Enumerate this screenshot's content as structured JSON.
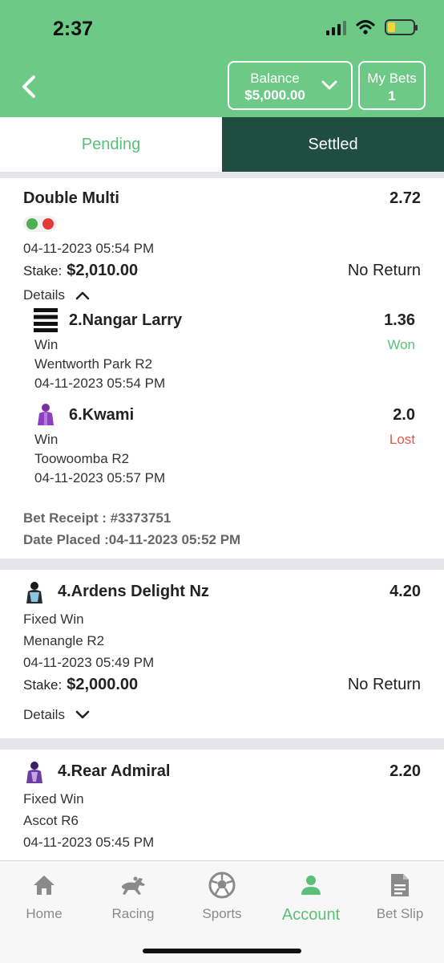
{
  "status": {
    "time": "2:37"
  },
  "header": {
    "balance_label": "Balance",
    "balance_value": "$5,000.00",
    "mybets_label": "My Bets",
    "mybets_count": "1"
  },
  "tabs": [
    {
      "label": "Pending",
      "active": false
    },
    {
      "label": "Settled",
      "active": true
    }
  ],
  "bets": {
    "multi": {
      "title": "Double Multi",
      "odds": "2.72",
      "leg_status_colors": [
        "#4caf50",
        "#e53935"
      ],
      "date": "04-11-2023 05:54 PM",
      "stake_label": "Stake:",
      "stake_value": "$2,010.00",
      "return_text": "No Return",
      "details_label": "Details",
      "legs": [
        {
          "runner": "2.Nangar Larry",
          "odds": "1.36",
          "bet_type": "Win",
          "race": "Wentworth Park R2",
          "date": "04-11-2023 05:54 PM",
          "result": "Won",
          "icon": "striped-silks-icon"
        },
        {
          "runner": "6.Kwami",
          "odds": "2.0",
          "bet_type": "Win",
          "race": "Toowoomba R2",
          "date": "04-11-2023 05:57 PM",
          "result": "Lost",
          "icon": "jockey-silks-icon"
        }
      ],
      "receipt": "Bet Receipt : #3373751",
      "date_placed": "Date Placed :04-11-2023 05:52 PM"
    },
    "single1": {
      "runner": "4.Ardens Delight Nz",
      "odds": "4.20",
      "bet_type": "Fixed Win",
      "race": "Menangle R2",
      "date": "04-11-2023 05:49 PM",
      "stake_label": "Stake:",
      "stake_value": "$2,000.00",
      "return_text": "No Return",
      "details_label": "Details"
    },
    "single2": {
      "runner": "4.Rear Admiral",
      "odds": "2.20",
      "bet_type": "Fixed Win",
      "race": "Ascot R6",
      "date": "04-11-2023 05:45 PM"
    }
  },
  "nav": [
    {
      "label": "Home",
      "icon": "home-icon"
    },
    {
      "label": "Racing",
      "icon": "horse-racing-icon"
    },
    {
      "label": "Sports",
      "icon": "soccer-ball-icon"
    },
    {
      "label": "Account",
      "icon": "user-icon",
      "active": true
    },
    {
      "label": "Bet Slip",
      "icon": "document-icon"
    }
  ],
  "colors": {
    "header_green": "#6cc986",
    "settled_tab": "#1f4d40",
    "won": "#5cbf78",
    "lost": "#e05a4b",
    "accent": "#5cbf78"
  }
}
